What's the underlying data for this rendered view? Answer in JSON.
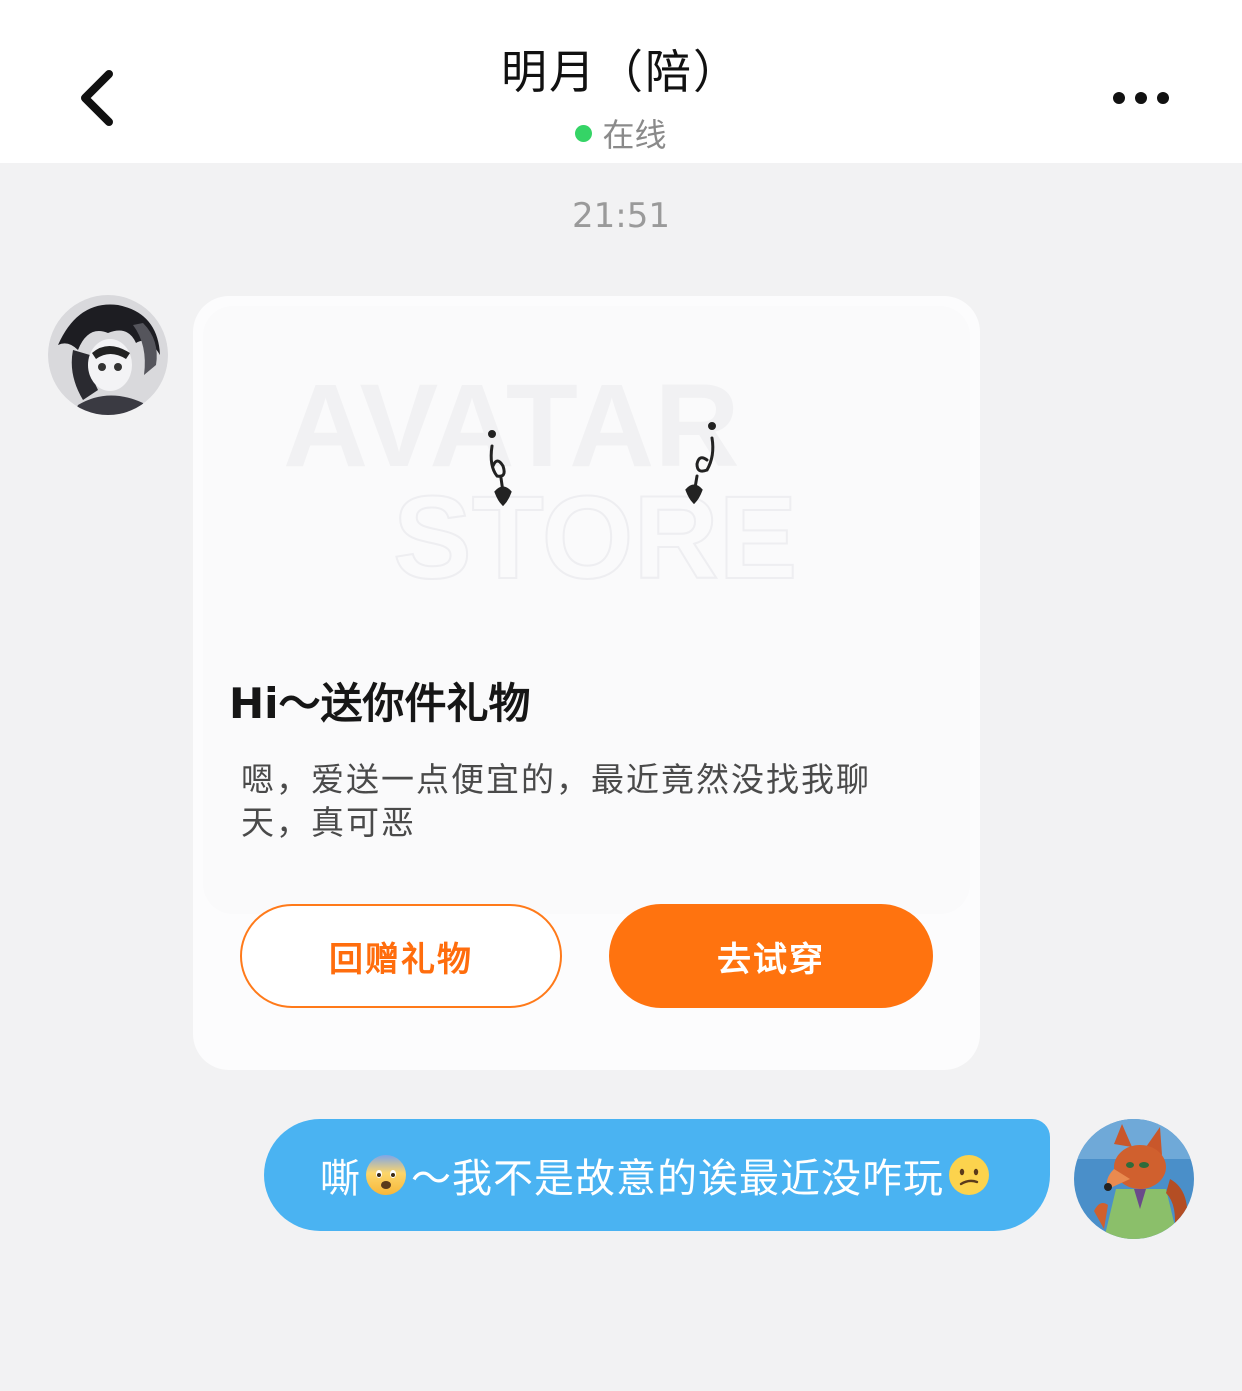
{
  "header": {
    "title": "明月（陪）",
    "status": "在线",
    "status_color": "#35d466",
    "back_icon": "chevron-left-icon",
    "more_icon": "more-dots-icon"
  },
  "timestamp": "21:51",
  "gift_card": {
    "preview_watermark_line1": "AVATAR",
    "preview_watermark_line2": "STORE",
    "title": "Hi～送你件礼物",
    "message": "嗯，爱送一点便宜的，最近竟然没找我聊天，真可恶",
    "return_gift_label": "回赠礼物",
    "try_on_label": "去试穿",
    "accent_color": "#ff730f"
  },
  "outgoing_message": {
    "part1": "嘶",
    "part2": "～我不是故意的诶最近没咋玩",
    "emoji1": "anxious-face-emoji",
    "emoji2": "confused-face-emoji",
    "bubble_color": "#4ab3f2"
  }
}
